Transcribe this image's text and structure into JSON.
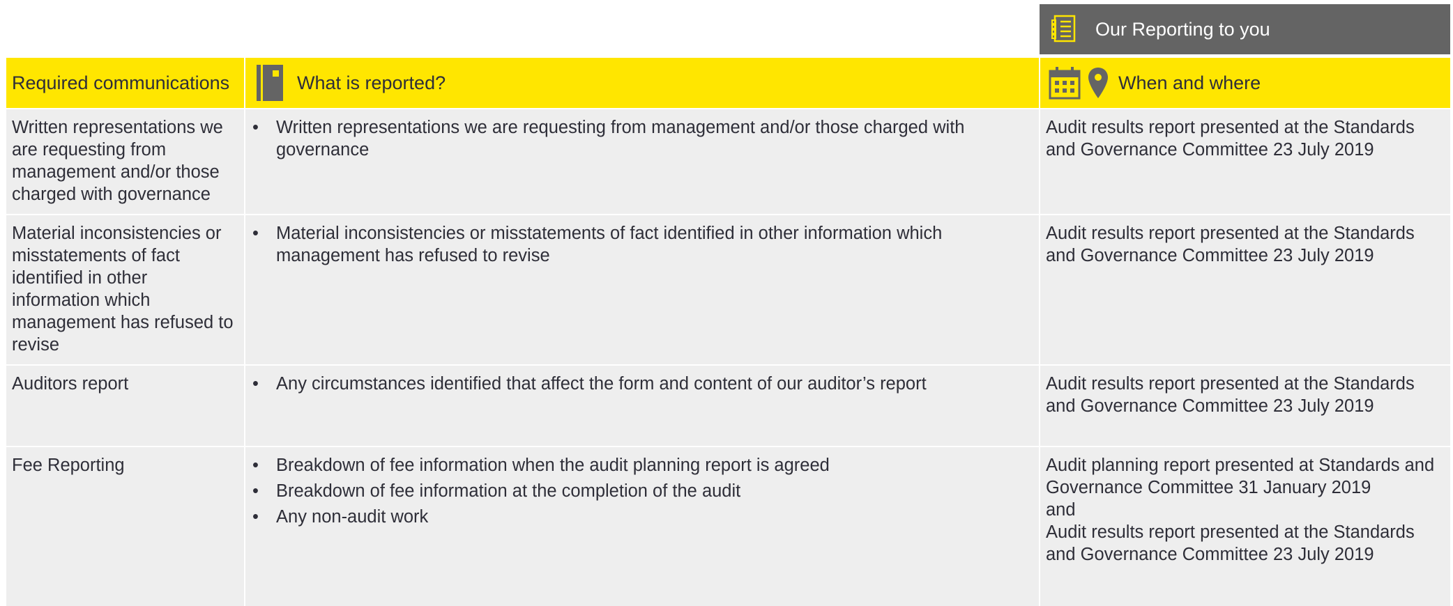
{
  "banner": {
    "title": "Our Reporting to you",
    "icon": "report-checklist-icon"
  },
  "headers": {
    "col1": "Required communications",
    "col2": "What is reported?",
    "col3": "When and where",
    "col2_icon": "notebook-icon",
    "col3_icons": [
      "calendar-icon",
      "location-pin-icon"
    ]
  },
  "rows": [
    {
      "communication": "Written representations we are requesting from management and/or those charged with governance",
      "reported": [
        "Written representations we are requesting from management and/or those charged with governance"
      ],
      "when_where": [
        "Audit results report presented at the Standards and Governance Committee 23 July 2019"
      ]
    },
    {
      "communication": "Material inconsistencies or misstatements of fact identified in other information which management has refused to revise",
      "reported": [
        "Material inconsistencies or misstatements of fact identified in other information which management has refused to revise"
      ],
      "when_where": [
        "Audit results report presented at the Standards and Governance Committee 23 July 2019"
      ]
    },
    {
      "communication": "Auditors report",
      "reported": [
        "Any circumstances identified that affect the form and content of our auditor’s report"
      ],
      "when_where": [
        "Audit results report presented at the Standards and Governance Committee 23 July 2019"
      ]
    },
    {
      "communication": "Fee Reporting",
      "reported": [
        "Breakdown of fee information when the  audit planning report is agreed",
        "Breakdown of fee information at the completion of the audit",
        "Any non-audit work"
      ],
      "when_where": [
        "Audit planning report presented at Standards and Governance Committee 31 January 2019",
        "and",
        "Audit results report presented at the Standards and Governance Committee 23 July 2019"
      ]
    }
  ],
  "colors": {
    "yellow": "#ffe600",
    "banner_grey": "#646464",
    "cell_grey": "#eeeeee",
    "text": "#2e2e38"
  }
}
